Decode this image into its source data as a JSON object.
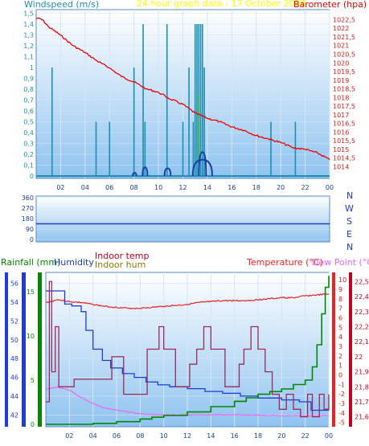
{
  "colors": {
    "background": "#ffffff",
    "plot_top": "#ffffff",
    "plot_bottom": "#8fc3f0",
    "grid": "#d4e6f7",
    "windspeed": "#1d8fb0",
    "windspeed_axis": "#00a0c0",
    "gust": "#1b3fa8",
    "barometer": "#ee0000",
    "wind_dir": "#1a3cc8",
    "rainfall": "#008800",
    "humidity": "#1f3cd6",
    "indoor_temp": "#c00020",
    "indoor_hum": "#8a7a00",
    "temperature": "#ee2222",
    "dew_point": "#ee66ee",
    "indoor_temp_line": "#9a2a5a",
    "title_yellow": "#ffff00"
  },
  "top_chart": {
    "title": "24 hour graph data - 17 October 2008",
    "left_label": "Windspeed (m/s)",
    "right_label": "Barometer (hpa)"
  },
  "mid_chart": {
    "letters": [
      "N",
      "W",
      "S",
      "E",
      "N"
    ]
  },
  "bottom_chart": {
    "labels": {
      "rainfall": "Rainfall (mm)",
      "humidity": "Humidity",
      "indoor_temp": "Indoor temp",
      "indoor_hum": "Indoor hum",
      "temperature": "Temperature (°C)",
      "dew_point": "Dew Point (°C)"
    }
  },
  "chart_data": [
    {
      "type": "line",
      "title": "24 hour graph data - 17 October 2008",
      "x_ticks": [
        "02",
        "04",
        "06",
        "08",
        "10",
        "12",
        "14",
        "16",
        "18",
        "20",
        "22",
        "00"
      ],
      "ylabel_left": "Windspeed (m/s)",
      "ylabel_right": "Barometer (hpa)",
      "ylim_left": [
        0,
        1.4
      ],
      "ylim_right": [
        1013.6,
        1022.8
      ],
      "yticks_left": [
        "0",
        "0,1",
        "0,2",
        "0,3",
        "0,4",
        "0,5",
        "0,6",
        "0,7",
        "0,8",
        "0,9",
        "1",
        "1,1",
        "1,2",
        "1,3",
        "1,4",
        "1,5"
      ],
      "yticks_right": [
        "1014",
        "1014,5",
        "1015",
        "1015,5",
        "1016",
        "1016,5",
        "1017",
        "1017,5",
        "1018",
        "1018,5",
        "1019",
        "1019,5",
        "1020",
        "1020,5",
        "1021",
        "1021,5",
        "1022",
        "1022,5"
      ],
      "windspeed_spikes": [
        {
          "t": 1.3,
          "v": 1.0
        },
        {
          "t": 4.9,
          "v": 0.5
        },
        {
          "t": 6.0,
          "v": 0.5
        },
        {
          "t": 8.0,
          "v": 1.0
        },
        {
          "t": 8.75,
          "v": 1.4
        },
        {
          "t": 8.9,
          "v": 0.5
        },
        {
          "t": 10.7,
          "v": 1.4
        },
        {
          "t": 12.0,
          "v": 0.5
        },
        {
          "t": 12.5,
          "v": 1.0
        },
        {
          "t": 12.85,
          "v": 0.5
        },
        {
          "t": 13.0,
          "v": 1.4
        },
        {
          "t": 13.15,
          "v": 1.4
        },
        {
          "t": 13.3,
          "v": 1.4
        },
        {
          "t": 13.45,
          "v": 1.4
        },
        {
          "t": 13.6,
          "v": 1.4
        },
        {
          "t": 13.75,
          "v": 1.0
        },
        {
          "t": 19.2,
          "v": 0.5
        },
        {
          "t": 21.2,
          "v": 0.5
        }
      ],
      "gust_bumps": [
        {
          "t0": 7.9,
          "t1": 8.2,
          "v": 0.03
        },
        {
          "t0": 8.7,
          "t1": 9.1,
          "v": 0.08
        },
        {
          "t0": 10.5,
          "t1": 11.0,
          "v": 0.07
        },
        {
          "t0": 12.8,
          "t1": 14.4,
          "v": 0.15
        },
        {
          "t0": 13.3,
          "t1": 13.9,
          "v": 0.22
        }
      ],
      "barometer": [
        [
          0,
          1022.6
        ],
        [
          0.5,
          1022.5
        ],
        [
          1,
          1022.1
        ],
        [
          2,
          1021.6
        ],
        [
          3,
          1021.0
        ],
        [
          4,
          1020.6
        ],
        [
          5,
          1020.1
        ],
        [
          6,
          1019.7
        ],
        [
          7,
          1019.2
        ],
        [
          8,
          1018.9
        ],
        [
          9,
          1018.5
        ],
        [
          10,
          1018.3
        ],
        [
          11,
          1017.9
        ],
        [
          12,
          1017.6
        ],
        [
          13,
          1017.1
        ],
        [
          14,
          1016.8
        ],
        [
          15,
          1016.6
        ],
        [
          16,
          1016.3
        ],
        [
          17,
          1016.1
        ],
        [
          18,
          1015.8
        ],
        [
          19,
          1015.6
        ],
        [
          20,
          1015.4
        ],
        [
          21,
          1015.1
        ],
        [
          22,
          1015.0
        ],
        [
          23,
          1014.8
        ],
        [
          24,
          1014.4
        ]
      ]
    },
    {
      "type": "line",
      "x_ticks": [
        "02",
        "04",
        "06",
        "08",
        "10",
        "12",
        "14",
        "16",
        "18",
        "20",
        "22",
        "00"
      ],
      "ylim": [
        0,
        360
      ],
      "yticks": [
        "0",
        "90",
        "180",
        "270",
        "360"
      ],
      "wind_direction": [
        [
          0,
          135
        ],
        [
          24,
          135
        ]
      ]
    },
    {
      "type": "line",
      "x_ticks": [
        "02",
        "04",
        "06",
        "08",
        "10",
        "12",
        "14",
        "16",
        "18",
        "20",
        "22",
        "00"
      ],
      "ylim_rainfall": [
        0,
        17
      ],
      "yticks_rainfall": [
        "0",
        "5",
        "10",
        "15"
      ],
      "ylim_humidity": [
        41,
        57
      ],
      "yticks_humidity": [
        "42",
        "44",
        "46",
        "48",
        "50",
        "52",
        "54",
        "56"
      ],
      "ylim_temperature": [
        -5.2,
        10.6
      ],
      "yticks_temperature": [
        "-5",
        "-4",
        "-3",
        "-2",
        "-1",
        "0",
        "1",
        "2",
        "3",
        "4",
        "5",
        "6",
        "7",
        "8",
        "9",
        "10"
      ],
      "ylim_indoor": [
        21.55,
        22.55
      ],
      "yticks_indoor": [
        "21,6",
        "21,7",
        "21,8",
        "21,9",
        "22",
        "22,1",
        "22,2",
        "22,3",
        "22,4",
        "22,5"
      ],
      "temperature": [
        [
          0,
          7.6
        ],
        [
          1,
          7.9
        ],
        [
          2,
          7.7
        ],
        [
          3,
          7.6
        ],
        [
          4,
          7.4
        ],
        [
          5,
          7.2
        ],
        [
          6,
          7.1
        ],
        [
          7,
          7.0
        ],
        [
          8,
          7.0
        ],
        [
          9,
          7.1
        ],
        [
          10,
          7.2
        ],
        [
          11,
          7.3
        ],
        [
          12,
          7.4
        ],
        [
          13,
          7.6
        ],
        [
          14,
          7.7
        ],
        [
          15,
          7.8
        ],
        [
          16,
          7.8
        ],
        [
          17,
          7.8
        ],
        [
          18,
          7.9
        ],
        [
          19,
          8.0
        ],
        [
          20,
          8.1
        ],
        [
          21,
          8.1
        ],
        [
          22,
          8.3
        ],
        [
          23,
          8.4
        ],
        [
          24,
          8.5
        ]
      ],
      "dew_point": [
        [
          0,
          -1.5
        ],
        [
          1,
          -1.3
        ],
        [
          2,
          -1.6
        ],
        [
          3,
          -2.4
        ],
        [
          4,
          -3.0
        ],
        [
          5,
          -3.5
        ],
        [
          6,
          -3.7
        ],
        [
          7,
          -3.9
        ],
        [
          8,
          -4.1
        ],
        [
          10,
          -4.2
        ],
        [
          12,
          -4.2
        ],
        [
          16,
          -4.2
        ],
        [
          20,
          -4.3
        ],
        [
          24,
          -4.3
        ]
      ],
      "humidity": [
        [
          0,
          55.2
        ],
        [
          1.6,
          53.8
        ],
        [
          2.2,
          53.6
        ],
        [
          3.0,
          53.0
        ],
        [
          3.4,
          51.0
        ],
        [
          4.0,
          49.0
        ],
        [
          4.8,
          47.8
        ],
        [
          5.5,
          47.0
        ],
        [
          6.5,
          46.4
        ],
        [
          7.5,
          46.0
        ],
        [
          8.5,
          45.5
        ],
        [
          9.5,
          45.2
        ],
        [
          10.5,
          45.0
        ],
        [
          12,
          44.8
        ],
        [
          13.5,
          44.5
        ],
        [
          15,
          44.3
        ],
        [
          16.5,
          44.0
        ],
        [
          18,
          43.8
        ],
        [
          20,
          43.6
        ],
        [
          21.5,
          43.4
        ],
        [
          22.5,
          42.5
        ],
        [
          24,
          42.5
        ]
      ],
      "rainfall": [
        [
          0,
          0
        ],
        [
          2,
          0
        ],
        [
          4,
          0.1
        ],
        [
          6,
          0.3
        ],
        [
          8,
          0.6
        ],
        [
          9,
          0.8
        ],
        [
          10,
          1.0
        ],
        [
          12,
          1.4
        ],
        [
          14,
          2.0
        ],
        [
          16,
          2.6
        ],
        [
          17,
          3.0
        ],
        [
          18,
          3.4
        ],
        [
          19,
          3.7
        ],
        [
          20,
          4.0
        ],
        [
          21,
          4.5
        ],
        [
          22,
          5.0
        ],
        [
          22.6,
          6.5
        ],
        [
          23.0,
          9.0
        ],
        [
          23.4,
          12.5
        ],
        [
          23.7,
          15.5
        ],
        [
          24,
          16.8
        ]
      ],
      "indoor_temp": [
        [
          0,
          21.7
        ],
        [
          0.3,
          22.5
        ],
        [
          0.5,
          21.9
        ],
        [
          0.8,
          22.2
        ],
        [
          1.1,
          21.8
        ],
        [
          2.0,
          21.8
        ],
        [
          2.4,
          21.85
        ],
        [
          5.0,
          21.85
        ],
        [
          5.6,
          22.0
        ],
        [
          6.2,
          22.0
        ],
        [
          6.6,
          21.75
        ],
        [
          8.2,
          21.75
        ],
        [
          8.6,
          22.05
        ],
        [
          9.2,
          22.05
        ],
        [
          9.6,
          22.2
        ],
        [
          10.0,
          22.05
        ],
        [
          10.6,
          22.05
        ],
        [
          11.0,
          21.8
        ],
        [
          11.6,
          21.8
        ],
        [
          12.2,
          21.95
        ],
        [
          12.8,
          22.05
        ],
        [
          13.4,
          22.2
        ],
        [
          14.0,
          22.05
        ],
        [
          14.6,
          22.05
        ],
        [
          15.2,
          21.8
        ],
        [
          15.8,
          21.8
        ],
        [
          16.4,
          21.95
        ],
        [
          16.8,
          22.05
        ],
        [
          17.4,
          22.2
        ],
        [
          18.0,
          22.05
        ],
        [
          18.6,
          21.9
        ],
        [
          19.2,
          21.75
        ],
        [
          19.8,
          21.65
        ],
        [
          20.4,
          21.75
        ],
        [
          21.0,
          21.65
        ],
        [
          21.6,
          21.6
        ],
        [
          22.2,
          21.75
        ],
        [
          22.6,
          21.6
        ],
        [
          23.2,
          21.75
        ],
        [
          23.6,
          21.65
        ],
        [
          24,
          21.75
        ]
      ]
    }
  ]
}
